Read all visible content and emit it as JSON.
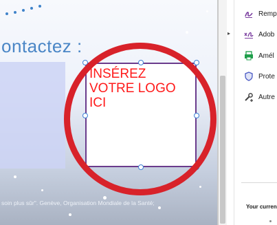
{
  "document": {
    "heading": "ontactez :",
    "logo_placeholder": [
      "INSÉREZ",
      "VOTRE LOGO",
      "ICI"
    ],
    "footer": "soin plus sûr\". Genève, Organisation Mondiale de la Santé;"
  },
  "tools_pane": {
    "items": [
      {
        "label": "Remp",
        "icon": "fill-sign-icon"
      },
      {
        "label": "Adob",
        "icon": "adobe-sign-icon"
      },
      {
        "label": "Amél",
        "icon": "enhance-scans-icon"
      },
      {
        "label": "Prote",
        "icon": "protect-icon"
      },
      {
        "label": "Autre",
        "icon": "more-tools-icon"
      }
    ],
    "footer_label": "Your curren"
  },
  "colors": {
    "annotation_ring": "#d8222a",
    "placeholder_text": "#ff1a1a",
    "heading": "#4a86c6",
    "selection": "#3b7fd4"
  }
}
